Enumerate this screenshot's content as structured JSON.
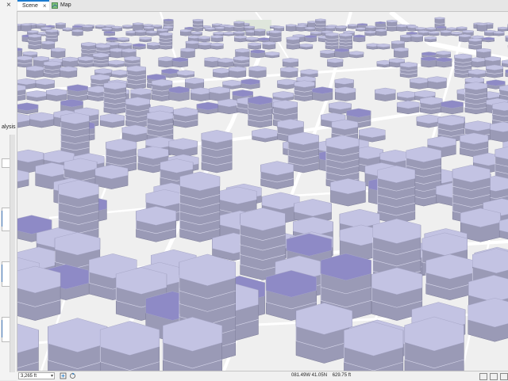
{
  "left_panel": {
    "close_glyph": "×",
    "text_fragment": "alysis"
  },
  "tabs": [
    {
      "label": "Scene",
      "active": true,
      "icon": "scene-globe-icon",
      "close": "×"
    },
    {
      "label": "Map",
      "active": false,
      "icon": "map-icon"
    }
  ],
  "status": {
    "scale": "1:3,265 ft",
    "scale_display": "3,265 ft",
    "coordinates": "081.49W 41.05N",
    "elevation": "629.75 ft"
  },
  "colors": {
    "hex_top": "#c3c3e3",
    "hex_top_dark": "#8e8ac6",
    "hex_side": "#9a9ab6",
    "map_bg": "#efefef",
    "road": "#ffffff",
    "tab_accent": "#1a7bd0"
  }
}
